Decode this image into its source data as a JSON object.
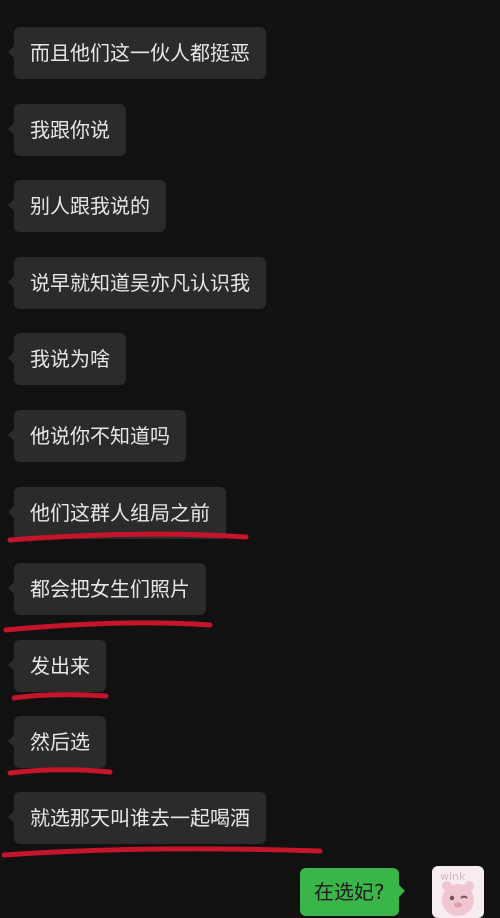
{
  "messages": [
    {
      "text": "而且他们这一伙人都挺恶"
    },
    {
      "text": "我跟你说"
    },
    {
      "text": "别人跟我说的"
    },
    {
      "text": "说早就知道吴亦凡认识我"
    },
    {
      "text": "我说为啥"
    },
    {
      "text": "他说你不知道吗"
    },
    {
      "text": "他们这群人组局之前"
    },
    {
      "text": "都会把女生们照片"
    },
    {
      "text": "发出来"
    },
    {
      "text": "然后选"
    },
    {
      "text": "就选那天叫谁去一起喝酒"
    }
  ],
  "self_message": {
    "text": "在选妃?"
  },
  "avatar": {
    "icon": "sticker-avatar",
    "text": "wink"
  },
  "colors": {
    "background": "#111111",
    "incoming_bubble": "#2b2b2b",
    "outgoing_bubble": "#39b54a",
    "annotation_red": "#c4152a"
  }
}
